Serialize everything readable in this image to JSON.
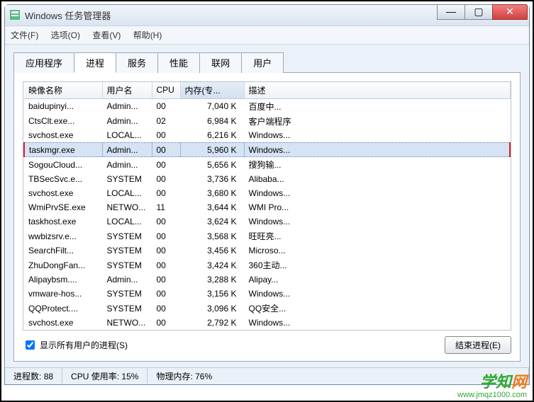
{
  "window": {
    "title": "Windows 任务管理器",
    "icon": "taskmgr-icon"
  },
  "menu": [
    "文件(F)",
    "选项(O)",
    "查看(V)",
    "帮助(H)"
  ],
  "tabs": [
    "应用程序",
    "进程",
    "服务",
    "性能",
    "联网",
    "用户"
  ],
  "active_tab_index": 1,
  "columns": {
    "image": "映像名称",
    "user": "用户名",
    "cpu": "CPU",
    "memory": "内存(专...",
    "desc": "描述"
  },
  "sorted_col": "memory",
  "processes": [
    {
      "image": "baidupinyi...",
      "user": "Admin...",
      "cpu": "00",
      "mem": "7,040 K",
      "desc": "百度中..."
    },
    {
      "image": "CtsClt.exe...",
      "user": "Admin...",
      "cpu": "02",
      "mem": "6,984 K",
      "desc": "客户端程序"
    },
    {
      "image": "svchost.exe",
      "user": "LOCAL...",
      "cpu": "00",
      "mem": "6,216 K",
      "desc": "Windows..."
    },
    {
      "image": "taskmgr.exe",
      "user": "Admin...",
      "cpu": "00",
      "mem": "5,960 K",
      "desc": "Windows...",
      "highlighted": true,
      "selected": true
    },
    {
      "image": "SogouCloud...",
      "user": "Admin...",
      "cpu": "00",
      "mem": "5,656 K",
      "desc": "搜狗输..."
    },
    {
      "image": "TBSecSvc.e...",
      "user": "SYSTEM",
      "cpu": "00",
      "mem": "3,736 K",
      "desc": "Alibaba..."
    },
    {
      "image": "svchost.exe",
      "user": "LOCAL...",
      "cpu": "00",
      "mem": "3,680 K",
      "desc": "Windows..."
    },
    {
      "image": "WmiPrvSE.exe",
      "user": "NETWO...",
      "cpu": "11",
      "mem": "3,644 K",
      "desc": "WMI Pro..."
    },
    {
      "image": "taskhost.exe",
      "user": "LOCAL...",
      "cpu": "00",
      "mem": "3,624 K",
      "desc": "Windows..."
    },
    {
      "image": "wwbizsrv.e...",
      "user": "SYSTEM",
      "cpu": "00",
      "mem": "3,568 K",
      "desc": "旺旺亮..."
    },
    {
      "image": "SearchFilt...",
      "user": "SYSTEM",
      "cpu": "00",
      "mem": "3,456 K",
      "desc": "Microso..."
    },
    {
      "image": "ZhuDongFan...",
      "user": "SYSTEM",
      "cpu": "00",
      "mem": "3,424 K",
      "desc": "360主动..."
    },
    {
      "image": "Alipaybsm....",
      "user": "Admin...",
      "cpu": "00",
      "mem": "3,288 K",
      "desc": "Alipay..."
    },
    {
      "image": "vmware-hos...",
      "user": "SYSTEM",
      "cpu": "00",
      "mem": "3,156 K",
      "desc": "Windows..."
    },
    {
      "image": "QQProtect....",
      "user": "SYSTEM",
      "cpu": "00",
      "mem": "3,096 K",
      "desc": "QQ安全..."
    },
    {
      "image": "svchost.exe",
      "user": "NETWO...",
      "cpu": "00",
      "mem": "2,792 K",
      "desc": "Windows..."
    }
  ],
  "panel_footer": {
    "checkbox_label": "显示所有用户的进程(S)",
    "checkbox_checked": true,
    "end_process_label": "结束进程(E)"
  },
  "status": {
    "processes_label": "进程数:",
    "processes_value": "88",
    "cpu_label": "CPU 使用率:",
    "cpu_value": "15%",
    "mem_label": "物理内存:",
    "mem_value": "76%"
  },
  "watermark": {
    "brand_green": "学知",
    "brand_orange": "网",
    "url": "www.jmqz1000.com"
  }
}
